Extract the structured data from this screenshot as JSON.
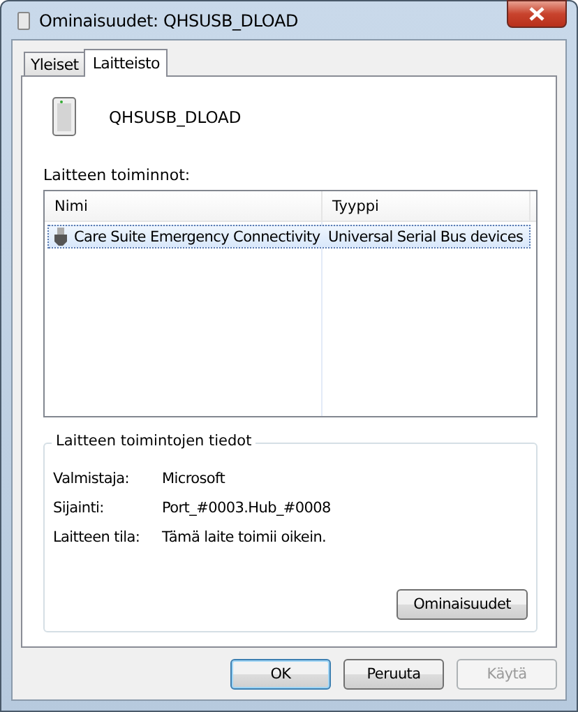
{
  "window": {
    "title": "Ominaisuudet: QHSUSB_DLOAD"
  },
  "tabs": [
    {
      "label": "Yleiset",
      "selected": false
    },
    {
      "label": "Laitteisto",
      "selected": true
    }
  ],
  "device_name": "QHSUSB_DLOAD",
  "functions": {
    "label": "Laitteen toiminnot:",
    "columns": [
      "Nimi",
      "Tyyppi"
    ],
    "rows": [
      {
        "name": "Care Suite Emergency Connectivity",
        "type": "Universal Serial Bus devices",
        "selected": true
      }
    ]
  },
  "details": {
    "title": "Laitteen toimintojen tiedot",
    "fields": [
      {
        "label": "Valmistaja:",
        "value": "Microsoft"
      },
      {
        "label": "Sijainti:",
        "value": "Port_#0003.Hub_#0008"
      },
      {
        "label": "Laitteen tila:",
        "value": "Tämä laite toimii oikein."
      }
    ],
    "button": "Ominaisuudet"
  },
  "buttons": [
    {
      "label": "OK",
      "kind": "default",
      "disabled": false
    },
    {
      "label": "Peruuta",
      "kind": "normal",
      "disabled": false
    },
    {
      "label": "Käytä",
      "kind": "normal",
      "disabled": true
    }
  ]
}
